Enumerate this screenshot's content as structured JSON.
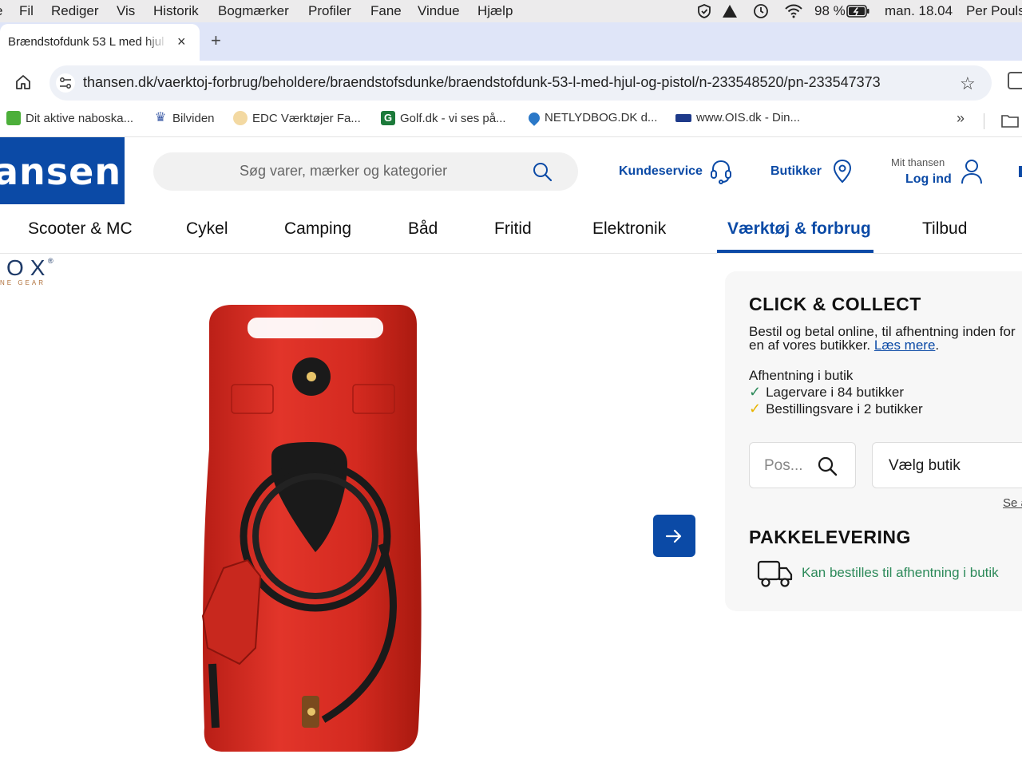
{
  "menubar": {
    "items": [
      "e",
      "Fil",
      "Rediger",
      "Vis",
      "Historik",
      "Bogmærker",
      "Profiler",
      "Fane",
      "Vindue",
      "Hjælp"
    ],
    "battery": "98 %",
    "clock": "man. 18.04",
    "user": "Per Pouls"
  },
  "browser": {
    "tab_title": "Brændstofdunk 53 L med hjul",
    "tab_close": "×",
    "new_tab": "+",
    "url": "thansen.dk/vaerktoj-forbrug/beholdere/braendstofsdunke/braendstofdunk-53-l-med-hjul-og-pistol/n-233548520/pn-233547373",
    "star": "☆"
  },
  "bookmarks": [
    {
      "label": "Dit aktive naboska...",
      "icon": "nabolag-icon",
      "color": "#4caf3a"
    },
    {
      "label": "Bilviden",
      "icon": "crown-icon",
      "color": "#3a5aa6"
    },
    {
      "label": "EDC  Værktøjer  Fa...",
      "icon": "edc-icon",
      "color": "#d9a03a"
    },
    {
      "label": "Golf.dk - vi ses på...",
      "icon": "golf-icon",
      "color": "#1c7a3a"
    },
    {
      "label": "NETLYDBOG.DK  d...",
      "icon": "drop-icon",
      "color": "#2a78c8"
    },
    {
      "label": "www.OIS.dk - Din...",
      "icon": "ois-icon",
      "color": "#1e3a8a"
    }
  ],
  "site": {
    "logo_text": "ansen",
    "search_placeholder": "Søg varer, mærker og kategorier",
    "customer_service": "Kundeservice",
    "stores": "Butikker",
    "my_account": "Mit thansen",
    "login": "Log ind"
  },
  "categories": [
    {
      "label": "Scooter & MC",
      "active": false
    },
    {
      "label": "Cykel",
      "active": false
    },
    {
      "label": "Camping",
      "active": false
    },
    {
      "label": "Båd",
      "active": false
    },
    {
      "label": "Fritid",
      "active": false
    },
    {
      "label": "Elektronik",
      "active": false
    },
    {
      "label": "Værktøj & forbrug",
      "active": true
    },
    {
      "label": "Tilbud",
      "active": false
    }
  ],
  "brand": {
    "letters": "OX",
    "sub": "NE GEAR"
  },
  "panel": {
    "title": "CLICK & COLLECT",
    "desc_line1": "Bestil og betal online, til afhentning inden for",
    "desc_line2_prefix": "en af vores butikker.",
    "read_more": "Læs mere",
    "desc_line2_suffix": ".",
    "pickup_heading": "Afhentning i butik",
    "stock_in": "Lagervare i 84 butikker",
    "stock_order": "Bestillingsvare i 2 butikker",
    "postal_placeholder": "Pos...",
    "store_select": "Vælg butik",
    "see_link": "Se a",
    "delivery_title": "PAKKELEVERING",
    "delivery_text": "Kan bestilles til afhentning i butik"
  },
  "colors": {
    "brand_blue": "#0b4aa6",
    "check_green": "#2d8a5a",
    "check_yellow": "#e8b400",
    "product_red": "#d8281e"
  }
}
